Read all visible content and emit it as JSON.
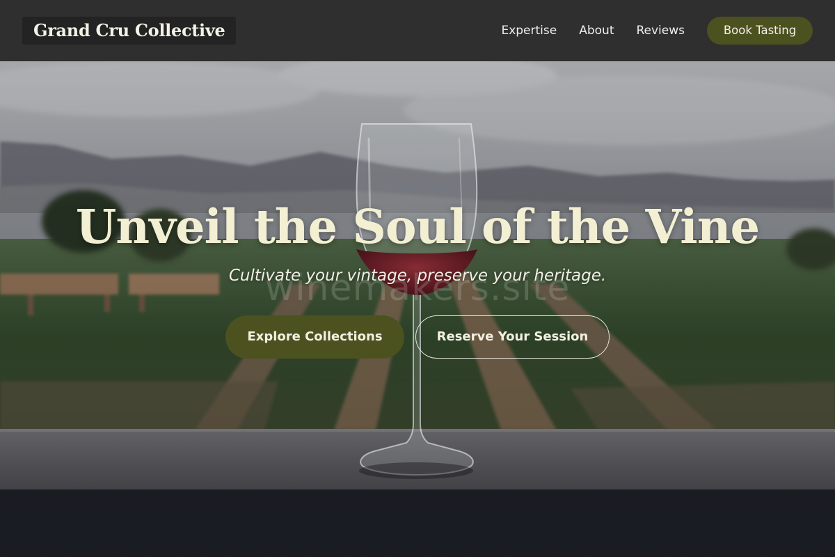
{
  "brand": {
    "name": "Grand Cru Collective"
  },
  "nav": {
    "links": [
      {
        "label": "Expertise"
      },
      {
        "label": "About"
      },
      {
        "label": "Reviews"
      }
    ],
    "cta_label": "Book Tasting"
  },
  "hero": {
    "headline": "Unveil the Soul of the Vine",
    "subheadline": "Cultivate your vintage, preserve your heritage.",
    "watermark": "winemakers.site",
    "primary_button": "Explore Collections",
    "secondary_button": "Reserve Your Session",
    "background_image": "vineyard-wine-glass-photo"
  },
  "colors": {
    "nav_background": "#2f2f2f",
    "accent_olive": "#4c5120",
    "headline_cream": "#f3efd3"
  }
}
